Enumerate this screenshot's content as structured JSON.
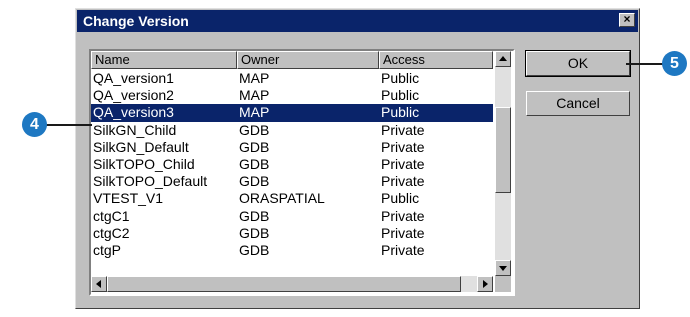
{
  "dialog": {
    "title": "Change Version",
    "close_label": "×"
  },
  "columns": {
    "name": "Name",
    "owner": "Owner",
    "access": "Access"
  },
  "rows": [
    {
      "name": "QA_version1",
      "owner": "MAP",
      "access": "Public",
      "selected": false
    },
    {
      "name": "QA_version2",
      "owner": "MAP",
      "access": "Public",
      "selected": false
    },
    {
      "name": "QA_version3",
      "owner": "MAP",
      "access": "Public",
      "selected": true
    },
    {
      "name": "SilkGN_Child",
      "owner": "GDB",
      "access": "Private",
      "selected": false
    },
    {
      "name": "SilkGN_Default",
      "owner": "GDB",
      "access": "Private",
      "selected": false
    },
    {
      "name": "SilkTOPO_Child",
      "owner": "GDB",
      "access": "Private",
      "selected": false
    },
    {
      "name": "SilkTOPO_Default",
      "owner": "GDB",
      "access": "Private",
      "selected": false
    },
    {
      "name": "VTEST_V1",
      "owner": "ORASPATIAL",
      "access": "Public",
      "selected": false
    },
    {
      "name": "ctgC1",
      "owner": "GDB",
      "access": "Private",
      "selected": false
    },
    {
      "name": "ctgC2",
      "owner": "GDB",
      "access": "Private",
      "selected": false
    },
    {
      "name": "ctgP",
      "owner": "GDB",
      "access": "Private",
      "selected": false
    }
  ],
  "buttons": {
    "ok": "OK",
    "cancel": "Cancel"
  },
  "callouts": {
    "select_step": "4",
    "ok_step": "5"
  },
  "colors": {
    "title_bar": "#0a246a",
    "selection": "#0a246a",
    "callout": "#1e78c2",
    "dialog_face": "#c0c0c0"
  }
}
